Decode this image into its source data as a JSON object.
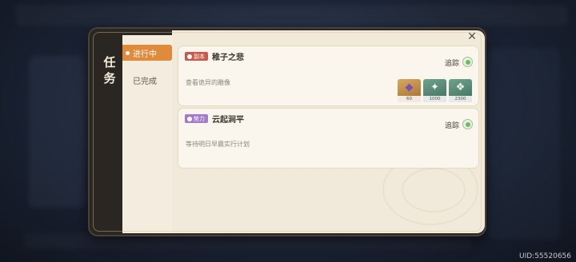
{
  "panel": {
    "title_chars": [
      "任",
      "务"
    ],
    "close_icon": "close-x-icon"
  },
  "tabs": [
    {
      "label": "进行中",
      "active": true
    },
    {
      "label": "已完成",
      "active": false
    }
  ],
  "quests": [
    {
      "tag": "副本",
      "tag_color": "#c9584a",
      "name": "稚子之悲",
      "description": "查看诡异的雕像",
      "track_label": "追踪",
      "rewards": [
        {
          "icon": "purple-gem-icon",
          "count": "60"
        },
        {
          "icon": "weapon-icon",
          "count": "1000"
        },
        {
          "icon": "fish-icon",
          "count": "2300"
        }
      ]
    },
    {
      "tag": "势力",
      "tag_color": "#a37ac9",
      "name": "云起涧平",
      "description": "等待明日早晨实行计划",
      "track_label": "追踪",
      "rewards": []
    }
  ],
  "footer": {
    "uid": "UID:55520656"
  }
}
